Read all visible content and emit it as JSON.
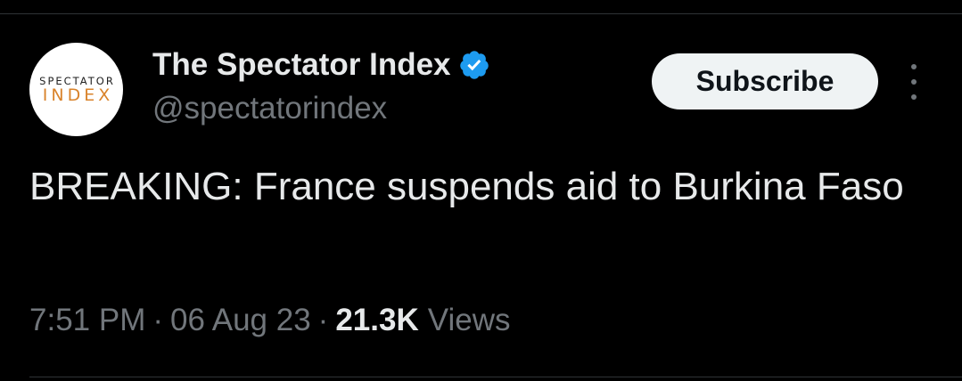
{
  "account": {
    "avatar_top": "SPECTATOR",
    "avatar_bottom": "INDEX",
    "display_name": "The Spectator Index",
    "handle": "@spectatorindex",
    "verified_icon": "verified-badge-icon",
    "verified_color": "#1d9bf0"
  },
  "actions": {
    "subscribe_label": "Subscribe",
    "more_icon": "more-vertical-icon"
  },
  "tweet": {
    "text": "BREAKING: France suspends aid to Burkina Faso"
  },
  "meta": {
    "time": "7:51 PM",
    "separator": "·",
    "date": "06 Aug 23",
    "views_count": "21.3K",
    "views_label": "Views"
  },
  "colors": {
    "background": "#000000",
    "text_primary": "#e7e9ea",
    "text_secondary": "#71767b",
    "avatar_accent": "#d9832b",
    "button_bg": "#eff3f4"
  }
}
